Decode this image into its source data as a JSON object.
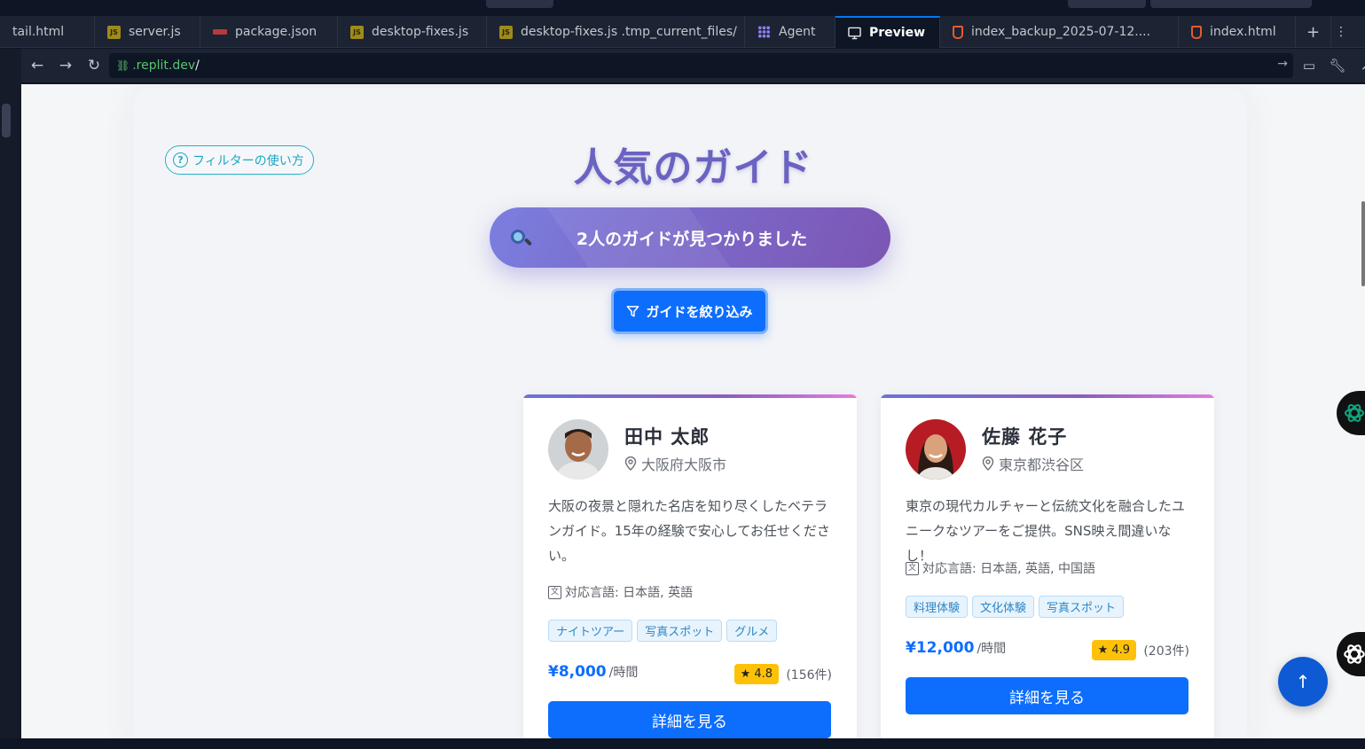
{
  "tabs": [
    {
      "label": "tail.html",
      "icon": "none"
    },
    {
      "label": "server.js",
      "icon": "js"
    },
    {
      "label": "package.json",
      "icon": "json"
    },
    {
      "label": "desktop-fixes.js",
      "icon": "js"
    },
    {
      "label": "desktop-fixes.js .tmp_current_files/",
      "icon": "js"
    },
    {
      "label": "Agent",
      "icon": "agent"
    },
    {
      "label": "Preview",
      "icon": "preview",
      "active": true
    },
    {
      "label": "index_backup_2025-07-12....",
      "icon": "html"
    },
    {
      "label": "index.html",
      "icon": "html"
    }
  ],
  "url": {
    "domain": ".replit.dev",
    "path": "/"
  },
  "page": {
    "help_label": "フィルターの使い方",
    "title": "人気のガイド",
    "result_text": "2人のガイドが見つかりました",
    "filter_button": "ガイドを絞り込み"
  },
  "guides": [
    {
      "name": "田中 太郎",
      "location": "大阪府大阪市",
      "description": "大阪の夜景と隠れた名店を知り尽くしたベテランガイド。15年の経験で安心してお任せください。",
      "languages": "対応言語: 日本語, 英語",
      "tags": [
        "ナイトツアー",
        "写真スポット",
        "グルメ"
      ],
      "price": "¥8,000",
      "price_unit": "/時間",
      "rating": "4.8",
      "reviews": "(156件)",
      "button": "詳細を見る"
    },
    {
      "name": "佐藤 花子",
      "location": "東京都渋谷区",
      "description": "東京の現代カルチャーと伝統文化を融合したユニークなツアーをご提供。SNS映え間違いなし！",
      "languages": "対応言語: 日本語, 英語, 中国語",
      "tags": [
        "料理体験",
        "文化体験",
        "写真スポット"
      ],
      "price": "¥12,000",
      "price_unit": "/時間",
      "rating": "4.9",
      "reviews": "(203件)",
      "button": "詳細を見る"
    }
  ],
  "colors": {
    "accent": "#0d6efd",
    "title": "#6a63c2",
    "rating": "#ffc107",
    "ide_bg": "#1c2333"
  }
}
